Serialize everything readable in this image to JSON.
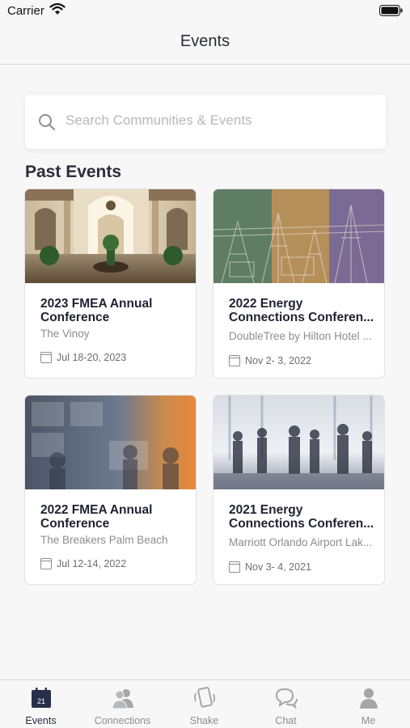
{
  "status_bar": {
    "carrier": "Carrier"
  },
  "nav": {
    "title": "Events"
  },
  "search": {
    "placeholder": "Search Communities & Events",
    "value": ""
  },
  "section": {
    "title": "Past Events"
  },
  "events": [
    {
      "title": "2023 FMEA Annual Conference",
      "venue": "The Vinoy",
      "dates": "Jul 18-20, 2023"
    },
    {
      "title": "2022 Energy Connections Conferen...",
      "venue": "DoubleTree by Hilton Hotel ...",
      "dates": "Nov 2- 3, 2022"
    },
    {
      "title": "2022 FMEA Annual Conference",
      "venue": "The Breakers Palm Beach",
      "dates": "Jul 12-14, 2022"
    },
    {
      "title": "2021 Energy Connections Conferen...",
      "venue": "Marriott Orlando Airport Lak...",
      "dates": "Nov 3- 4, 2021"
    }
  ],
  "tab_bar": {
    "events": {
      "label": "Events",
      "icon": "calendar-icon",
      "badge": "21"
    },
    "connections": {
      "label": "Connections",
      "icon": "people-icon"
    },
    "shake": {
      "label": "Shake",
      "icon": "shake-phone-icon"
    },
    "chat": {
      "label": "Chat",
      "icon": "chat-bubbles-icon"
    },
    "me": {
      "label": "Me",
      "icon": "person-icon"
    }
  },
  "colors": {
    "active_tab": "#27304a",
    "inactive_tab": "#8e8e93",
    "background": "#f7f7f8"
  }
}
